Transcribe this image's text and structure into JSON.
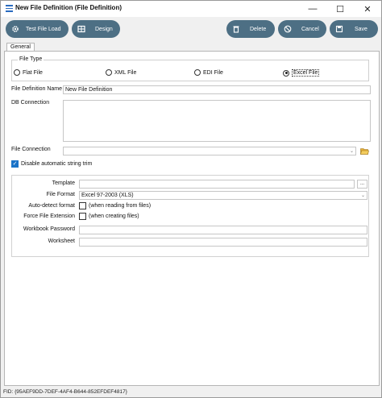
{
  "window": {
    "title": "New File Definition (File Definition)",
    "controls": {
      "minimize": "—",
      "maximize": "☐",
      "close": "✕"
    }
  },
  "toolbar": {
    "test_file_load": "Test File Load",
    "design": "Design",
    "delete": "Delete",
    "cancel": "Cancel",
    "save": "Save",
    "button_color": "#4d6f84"
  },
  "tabs": [
    {
      "label": "General",
      "active": true
    }
  ],
  "file_type": {
    "title": "File Type",
    "options": [
      {
        "label": "Flat File",
        "selected": false
      },
      {
        "label": "XML File",
        "selected": false
      },
      {
        "label": "EDI File",
        "selected": false
      },
      {
        "label": "Excel File",
        "selected": true
      }
    ]
  },
  "form": {
    "file_definition_name_label": "File Definition Name",
    "file_definition_name_value": "New File Definition",
    "db_connection_label": "DB Connection",
    "db_connection_value": "",
    "file_connection_label": "File Connection",
    "file_connection_value": "",
    "disable_trim_label": "Disable automatic string trim",
    "disable_trim_checked": true
  },
  "excel_options": {
    "template_label": "Template",
    "template_value": "",
    "browse_label": "...",
    "file_format_label": "File Format",
    "file_format_value": "Excel 97-2003 (XLS)",
    "auto_detect_label": "Auto-detect format",
    "auto_detect_hint": "(when reading from files)",
    "auto_detect_checked": false,
    "force_ext_label": "Force File Extension",
    "force_ext_hint": "(when creating files)",
    "force_ext_checked": false,
    "workbook_password_label": "Workbook Password",
    "workbook_password_value": "",
    "worksheet_label": "Worksheet",
    "worksheet_value": ""
  },
  "status": {
    "fid": "FID: {95AEF9DD-7DEF-4AF4-B644-852EFDEF4817}"
  }
}
